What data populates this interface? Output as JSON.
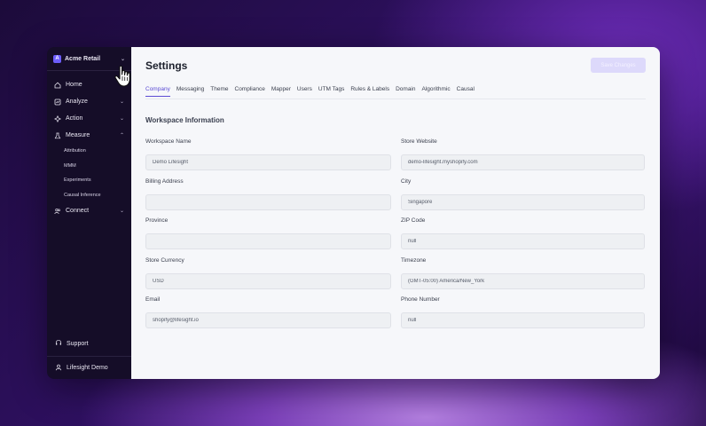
{
  "sidebar": {
    "workspace": {
      "logo_letter": "A",
      "name": "Acme Retail"
    },
    "nav": [
      {
        "label": "Home",
        "icon": "home-icon",
        "chevron": false
      },
      {
        "label": "Analyze",
        "icon": "analyze-icon",
        "chevron": true
      },
      {
        "label": "Action",
        "icon": "action-icon",
        "chevron": true
      },
      {
        "label": "Measure",
        "icon": "flask-icon",
        "chevron": true
      }
    ],
    "measure_sub": [
      "Attribution",
      "MMM",
      "Experiments",
      "Causal Inference"
    ],
    "connect": {
      "label": "Connect",
      "icon": "users-icon"
    },
    "support": "Support",
    "user": "Lifesight Demo"
  },
  "header": {
    "title": "Settings",
    "save_label": "Save Changes"
  },
  "tabs": [
    "Company",
    "Messaging",
    "Theme",
    "Compliance",
    "Mapper",
    "Users",
    "UTM Tags",
    "Rules & Labels",
    "Domain",
    "Algorithmic",
    "Causal"
  ],
  "active_tab": "Company",
  "section_title": "Workspace Information",
  "fields": {
    "workspace_name": {
      "label": "Workspace Name",
      "value": "Demo Lifesight"
    },
    "store_website": {
      "label": "Store Website",
      "value": "demo-lifesight.myshopify.com"
    },
    "billing_address": {
      "label": "Billing Address",
      "value": ""
    },
    "city": {
      "label": "City",
      "value": "Singapore"
    },
    "province": {
      "label": "Province",
      "value": ""
    },
    "zip_code": {
      "label": "ZIP Code",
      "value": "null"
    },
    "store_currency": {
      "label": "Store Currency",
      "value": "USD"
    },
    "timezone": {
      "label": "Timezone",
      "value": "(GMT-05:00) America/New_York"
    },
    "email": {
      "label": "Email",
      "value": "shopify@lifesight.io"
    },
    "phone_number": {
      "label": "Phone Number",
      "value": "null"
    }
  },
  "colors": {
    "accent": "#5b4bd4",
    "sidebar_bg": "#150d28",
    "save_button_bg": "#ddd9fb"
  }
}
